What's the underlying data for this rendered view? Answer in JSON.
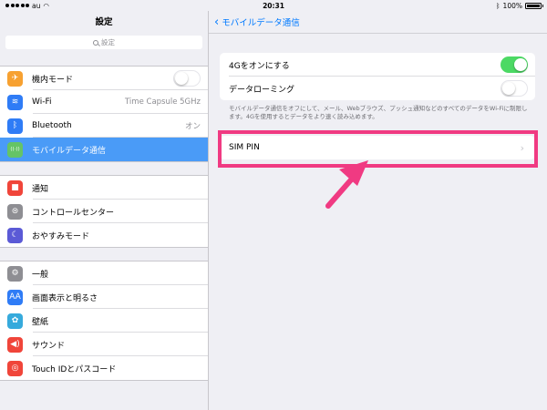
{
  "status": {
    "carrier": "au",
    "time": "20:31",
    "battery": "100%"
  },
  "left": {
    "title": "設定",
    "search_placeholder": "設定",
    "group1": [
      {
        "label": "機内モード",
        "icon": "airplane-icon",
        "color": "#f7a131",
        "glyph": "✈",
        "toggle": "off"
      },
      {
        "label": "Wi-Fi",
        "icon": "wifi-icon",
        "color": "#2f7cf6",
        "glyph": "≋",
        "detail": "Time Capsule 5GHz"
      },
      {
        "label": "Bluetooth",
        "icon": "bluetooth-icon",
        "color": "#2f7cf6",
        "glyph": "ᛒ",
        "detail": "オン"
      },
      {
        "label": "モバイルデータ通信",
        "icon": "cellular-icon",
        "color": "#65c466",
        "glyph": "((·))",
        "selected": true
      }
    ],
    "group2": [
      {
        "label": "通知",
        "icon": "notifications-icon",
        "color": "#f0453a",
        "glyph": "■"
      },
      {
        "label": "コントロールセンター",
        "icon": "control-center-icon",
        "color": "#8e8e93",
        "glyph": "⊜"
      },
      {
        "label": "おやすみモード",
        "icon": "moon-icon",
        "color": "#5b5ad6",
        "glyph": "☾"
      }
    ],
    "group3": [
      {
        "label": "一般",
        "icon": "gear-icon",
        "color": "#8e8e93",
        "glyph": "⚙"
      },
      {
        "label": "画面表示と明るさ",
        "icon": "display-icon",
        "color": "#2f7cf6",
        "glyph": "AA"
      },
      {
        "label": "壁紙",
        "icon": "wallpaper-icon",
        "color": "#36aadc",
        "glyph": "✿"
      },
      {
        "label": "サウンド",
        "icon": "sound-icon",
        "color": "#f0453a",
        "glyph": "◀)"
      },
      {
        "label": "Touch IDとパスコード",
        "icon": "fingerprint-icon",
        "color": "#f0453a",
        "glyph": "◎"
      }
    ]
  },
  "right": {
    "back_label": "モバイルデータ通信",
    "toggles": [
      {
        "label": "4Gをオンにする",
        "state": "on"
      },
      {
        "label": "データローミング",
        "state": "off"
      }
    ],
    "note": "モバイルデータ通信をオフにして、メール、Webブラウズ、プッシュ通知などのすべてのデータをWi-Fiに制限します。4Gを使用するとデータをより速く読み込めます。",
    "sim_pin_label": "SIM PIN"
  },
  "accent": {
    "highlight": "#f03a82",
    "link": "#007aff",
    "selected": "#4a9bf7",
    "toggle_on": "#4cd964"
  }
}
